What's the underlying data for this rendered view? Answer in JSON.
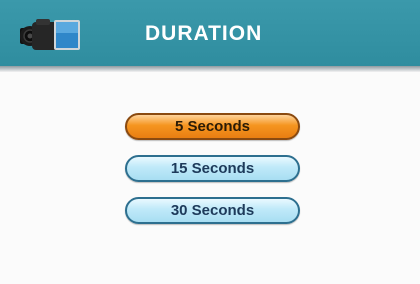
{
  "header": {
    "title": "DURATION",
    "icon": "video-camera-icon",
    "background": "#3297a9"
  },
  "options": [
    {
      "label": "5 Seconds",
      "selected": true
    },
    {
      "label": "15 Seconds",
      "selected": false
    },
    {
      "label": "30 Seconds",
      "selected": false
    }
  ],
  "colors": {
    "selected_button": "#f39325",
    "button": "#bfe9f9",
    "button_border": "#2d6f8f"
  }
}
